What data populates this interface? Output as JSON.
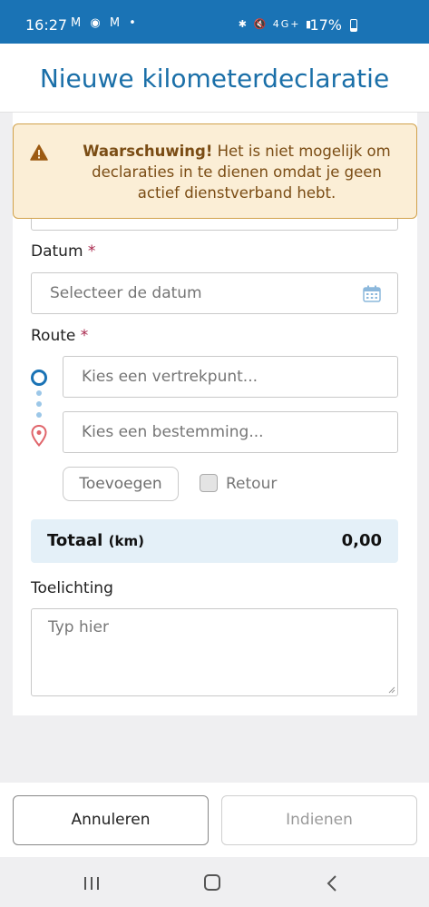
{
  "status_bar": {
    "time": "16:27",
    "left_icons": "M ◉ M •",
    "right_icons": "✱ 🔇 4G+ ▮",
    "battery": "17%"
  },
  "header": {
    "title": "Nieuwe kilometerdeclaratie"
  },
  "warning": {
    "icon": "warning-triangle-icon",
    "title": "Waarschuwing!",
    "message": "Het is niet mogelijk om declaraties in te dienen omdat je geen actief dienstverband hebt."
  },
  "form": {
    "date_label": "Datum",
    "required_mark": "*",
    "date_placeholder": "Selecteer de datum",
    "route_label": "Route",
    "departure_placeholder": "Kies een vertrekpunt...",
    "destination_placeholder": "Kies een bestemming...",
    "add_button": "Toevoegen",
    "return_label": "Retour",
    "return_checked": false,
    "total_label": "Totaal",
    "total_unit": "(km)",
    "total_value": "0,00",
    "note_label": "Toelichting",
    "note_placeholder": "Typ hier"
  },
  "actions": {
    "cancel": "Annuleren",
    "submit": "Indienen"
  },
  "colors": {
    "brand_blue": "#1a73b5",
    "title_blue": "#1a6fa8",
    "warning_bg": "#fbeed6",
    "warning_text": "#7a4c14",
    "required": "#a8254a",
    "total_bg": "#e4f0f8",
    "pin_red": "#e0656b"
  }
}
